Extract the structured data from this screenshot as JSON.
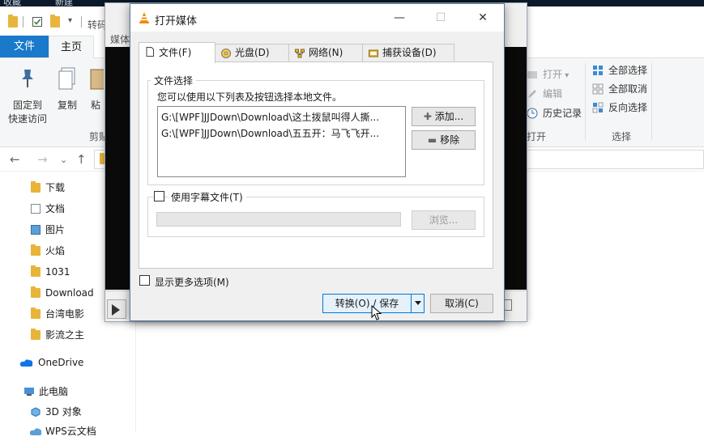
{
  "top_strip": {
    "left_text": "收藏",
    "mid_text": "新建"
  },
  "explorer": {
    "quick_access_title": "转码",
    "tabs": {
      "file": "文件",
      "home": "主页",
      "view": "媒体"
    },
    "ribbon": {
      "pin_label_1": "固定到",
      "pin_label_2": "快速访问",
      "copy_label": "复制",
      "paste_label": "粘",
      "clipboard_group": "剪贴",
      "open_label": "打开",
      "edit_label": "编辑",
      "history_label": "历史记录",
      "open_group": "打开",
      "select_all": "全部选择",
      "select_none": "全部取消",
      "invert_select": "反向选择",
      "select_group": "选择"
    },
    "nav_items": [
      {
        "label": "下载",
        "icon": "download-folder-icon"
      },
      {
        "label": "文档",
        "icon": "documents-icon"
      },
      {
        "label": "图片",
        "icon": "pictures-icon"
      },
      {
        "label": "火焰",
        "icon": "folder-icon"
      },
      {
        "label": "1031",
        "icon": "folder-icon"
      },
      {
        "label": "Download",
        "icon": "folder-icon"
      },
      {
        "label": "台湾电影",
        "icon": "folder-icon"
      },
      {
        "label": "影流之主",
        "icon": "folder-icon"
      }
    ],
    "onedrive": "OneDrive",
    "this_pc": "此电脑",
    "objects_3d": "3D 对象",
    "wps_cloud": "WPS云文档"
  },
  "dialog": {
    "title": "打开媒体",
    "tabs": [
      {
        "label": "文件(F)",
        "icon": "file-icon"
      },
      {
        "label": "光盘(D)",
        "icon": "disc-icon"
      },
      {
        "label": "网络(N)",
        "icon": "network-icon"
      },
      {
        "label": "捕获设备(D)",
        "icon": "capture-device-icon"
      }
    ],
    "file_group": {
      "legend": "文件选择",
      "hint": "您可以使用以下列表及按钮选择本地文件。",
      "files": [
        "G:\\[WPF]JJDown\\Download\\这土拨鼠叫得人撕...",
        "G:\\[WPF]JJDown\\Download\\五五开：马飞飞开..."
      ],
      "add_button": "添加...",
      "remove_button": "移除"
    },
    "subtitle": {
      "checkbox_label": "使用字幕文件(T)",
      "browse_button": "浏览..."
    },
    "more_options": "显示更多选项(M)",
    "convert_button": "转换(O) / 保存",
    "cancel_button": "取消(C)"
  },
  "colors": {
    "accent": "#0078d7",
    "file_tab": "#1979ca",
    "folder": "#e8b53a"
  }
}
